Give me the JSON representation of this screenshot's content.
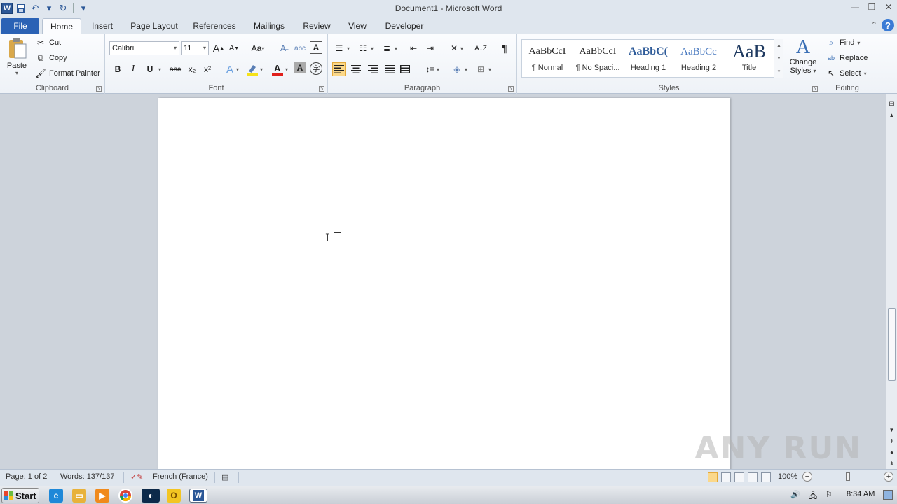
{
  "window": {
    "title": "Document1 - Microsoft Word",
    "app_logo": "W",
    "controls": [
      "minimize-icon",
      "restore-icon",
      "close-icon"
    ]
  },
  "tabs": {
    "items": [
      "File",
      "Home",
      "Insert",
      "Page Layout",
      "References",
      "Mailings",
      "Review",
      "View",
      "Developer"
    ],
    "active": "Home",
    "help": "?"
  },
  "ribbon": {
    "clipboard": {
      "label": "Clipboard",
      "paste": "Paste",
      "cut": "Cut",
      "copy": "Copy",
      "format_painter": "Format Painter"
    },
    "font": {
      "label": "Font",
      "font_name": "Calibri",
      "font_size": "11",
      "bold": "B",
      "italic": "I",
      "underline": "U",
      "strike": "abc",
      "subscript": "x₂",
      "superscript": "x²",
      "change_case": "Aa",
      "grow": "A",
      "shrink": "A"
    },
    "paragraph": {
      "label": "Paragraph",
      "pilcrow": "¶"
    },
    "styles": {
      "label": "Styles",
      "items": [
        {
          "preview": "AaBbCcI",
          "name": "¶ Normal"
        },
        {
          "preview": "AaBbCcI",
          "name": "¶ No Spaci..."
        },
        {
          "preview": "AaBbC(",
          "name": "Heading 1"
        },
        {
          "preview": "AaBbCc",
          "name": "Heading 2"
        },
        {
          "preview": "AaB",
          "name": "Title"
        }
      ],
      "change_styles_line1": "Change",
      "change_styles_line2": "Styles"
    },
    "editing": {
      "label": "Editing",
      "find": "Find",
      "replace": "Replace",
      "select": "Select"
    }
  },
  "document": {
    "watermark": "ANY RUN"
  },
  "statusbar": {
    "page": "Page: 1 of 2",
    "words": "Words: 137/137",
    "language": "French (France)",
    "zoom": "100%",
    "zoom_minus": "−",
    "zoom_plus": "+"
  },
  "taskbar": {
    "start": "Start",
    "clock": "8:34 AM"
  },
  "colors": {
    "file_tab": "#2b62b5",
    "accent_selected": "#fbd88a",
    "ribbon_bg": "#fbfcfe"
  }
}
